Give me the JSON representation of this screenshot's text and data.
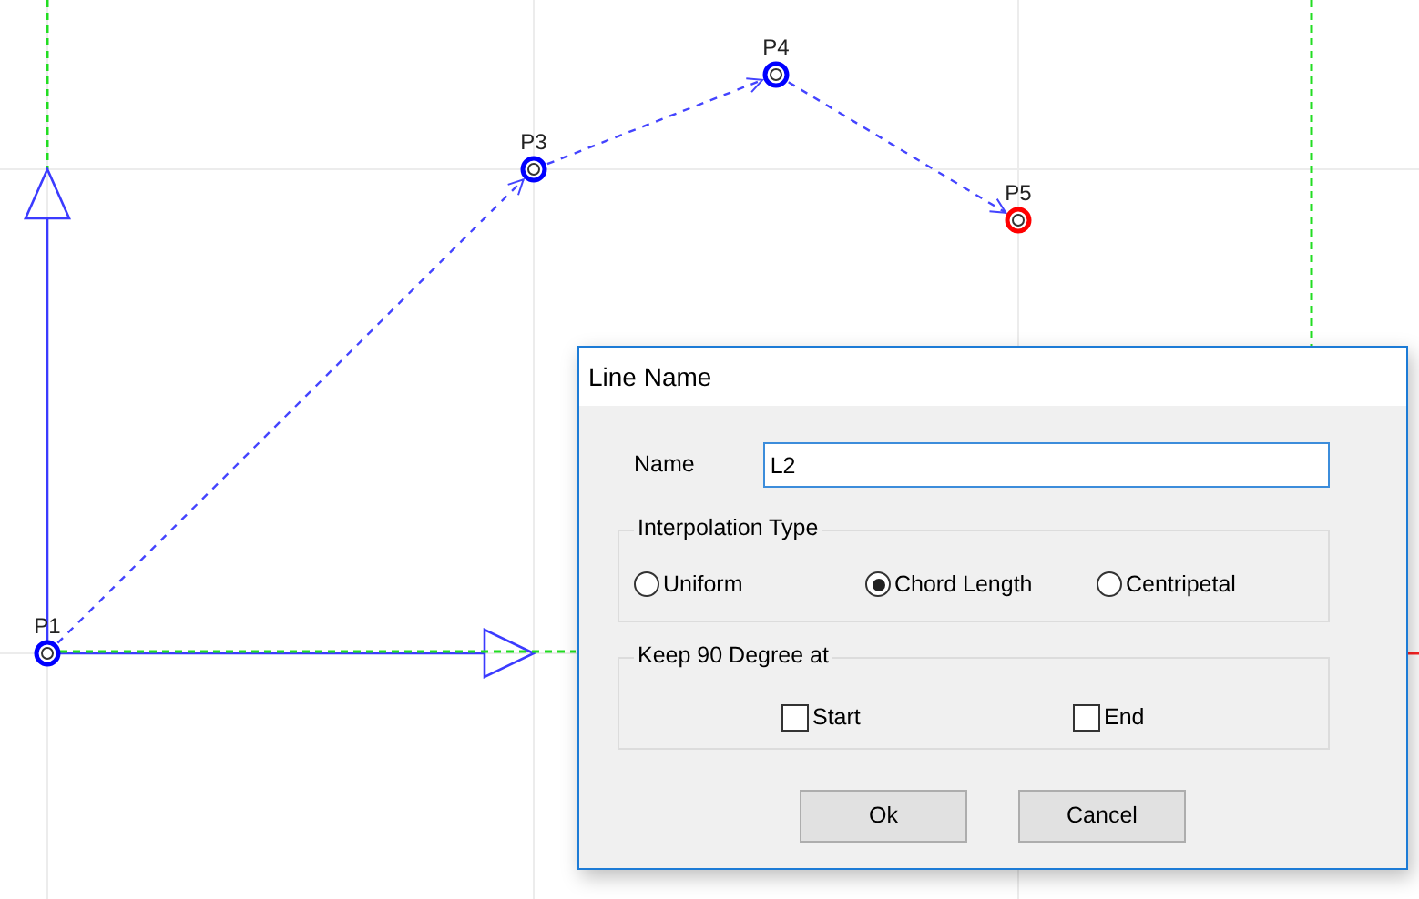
{
  "canvas": {
    "points": [
      {
        "label": "P1",
        "selected": false
      },
      {
        "label": "P3",
        "selected": false
      },
      {
        "label": "P4",
        "selected": false
      },
      {
        "label": "P5",
        "selected": true
      }
    ]
  },
  "dialog": {
    "title": "Line Name",
    "name_field": {
      "label": "Name",
      "value": "L2"
    },
    "interpolation": {
      "legend": "Interpolation Type",
      "options": [
        {
          "label": "Uniform",
          "selected": false
        },
        {
          "label": "Chord Length",
          "selected": true
        },
        {
          "label": "Centripetal",
          "selected": false
        }
      ]
    },
    "keep_90": {
      "legend": "Keep 90 Degree at",
      "options": [
        {
          "label": "Start",
          "checked": false
        },
        {
          "label": "End",
          "checked": false
        }
      ]
    },
    "buttons": [
      "Ok",
      "Cancel"
    ]
  }
}
